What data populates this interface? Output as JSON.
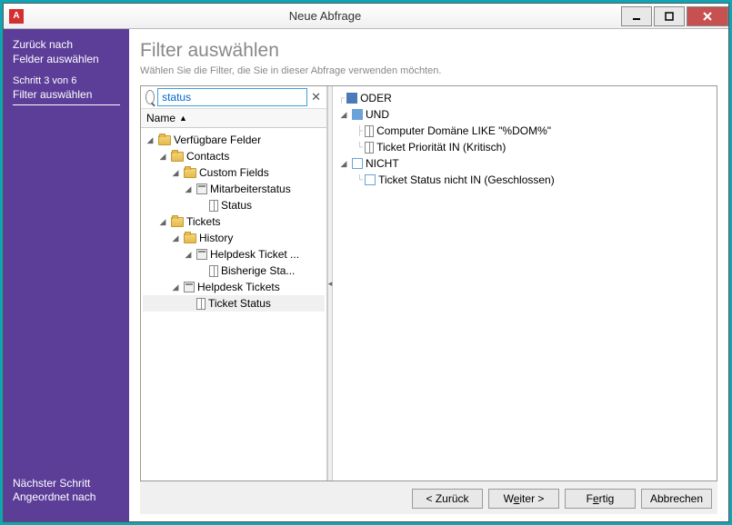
{
  "window": {
    "title": "Neue Abfrage",
    "app_glyph": "A"
  },
  "sidebar": {
    "back_line1": "Zurück nach",
    "back_line2": "Felder auswählen",
    "step_label": "Schritt 3 von 6",
    "step_title": "Filter auswählen",
    "next_line1": "Nächster Schritt",
    "next_line2": "Angeordnet nach"
  },
  "main": {
    "heading": "Filter auswählen",
    "subheading": "Wählen Sie die Filter, die Sie in dieser Abfrage verwenden möchten."
  },
  "search": {
    "value": "status"
  },
  "column_header": "Name",
  "left_tree": {
    "root": "Verfügbare Felder",
    "contacts": "Contacts",
    "custom_fields": "Custom Fields",
    "mitarbeiterstatus": "Mitarbeiterstatus",
    "status": "Status",
    "tickets": "Tickets",
    "history": "History",
    "helpdesk_ticket": "Helpdesk Ticket ...",
    "bisherige": "Bisherige Sta...",
    "helpdesk_tickets": "Helpdesk Tickets",
    "ticket_status": "Ticket Status"
  },
  "right_tree": {
    "oder": "ODER",
    "und": "UND",
    "computer": "Computer Domäne LIKE  \"%DOM%\"",
    "priority": "Ticket Priorität IN (Kritisch)",
    "nicht": "NICHT",
    "status": "Ticket Status nicht IN (Geschlossen)"
  },
  "buttons": {
    "back": "< Zurück",
    "next_pre": "W",
    "next_u": "e",
    "next_post": "iter >",
    "finish_pre": "F",
    "finish_u": "e",
    "finish_post": "rtig",
    "cancel": "Abbrechen"
  }
}
